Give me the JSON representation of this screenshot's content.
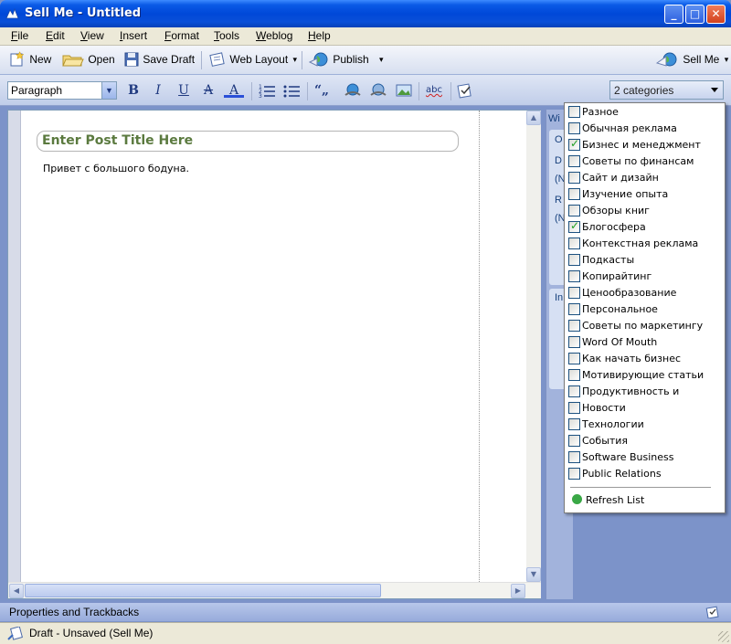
{
  "window": {
    "title": "Sell Me - Untitled",
    "buttons": {
      "minimize": "_",
      "maximize": "□",
      "close": "✕"
    }
  },
  "menu": [
    "File",
    "Edit",
    "View",
    "Insert",
    "Format",
    "Tools",
    "Weblog",
    "Help"
  ],
  "toolbar": {
    "new_label": "New",
    "open_label": "Open",
    "save_draft_label": "Save Draft",
    "web_layout_label": "Web Layout",
    "publish_label": "Publish",
    "blog_label": "Sell Me",
    "dropdown_glyph": "▾"
  },
  "format_toolbar": {
    "paragraph_style": "Paragraph",
    "bold": "B",
    "italic": "I",
    "underline": "U",
    "strikethrough": "A",
    "font_color": "A",
    "quote": "“„",
    "spell": "abc"
  },
  "categories": {
    "selected_summary": "2 categories",
    "items": [
      {
        "label": "Разное",
        "checked": false
      },
      {
        "label": "Обычная реклама",
        "checked": false
      },
      {
        "label": "Бизнес и менеджмент",
        "checked": true
      },
      {
        "label": "Советы по финансам",
        "checked": false
      },
      {
        "label": "Сайт и дизайн",
        "checked": false
      },
      {
        "label": "Изучение опыта",
        "checked": false
      },
      {
        "label": "Обзоры книг",
        "checked": false
      },
      {
        "label": "Блогосфера",
        "checked": true
      },
      {
        "label": "Контекстная реклама",
        "checked": false
      },
      {
        "label": "Подкасты",
        "checked": false
      },
      {
        "label": "Копирайтинг",
        "checked": false
      },
      {
        "label": "Ценообразование",
        "checked": false
      },
      {
        "label": "Персональное",
        "checked": false
      },
      {
        "label": "Советы по маркетингу",
        "checked": false
      },
      {
        "label": "Word Of Mouth",
        "checked": false
      },
      {
        "label": "Как начать бизнес",
        "checked": false
      },
      {
        "label": "Мотивирующие статьи",
        "checked": false
      },
      {
        "label": "Продуктивность и",
        "checked": false
      },
      {
        "label": "Новости",
        "checked": false
      },
      {
        "label": "Технологии",
        "checked": false
      },
      {
        "label": "События",
        "checked": false
      },
      {
        "label": "Software Business",
        "checked": false
      },
      {
        "label": "Public Relations",
        "checked": false
      }
    ],
    "refresh_label": "Refresh List"
  },
  "editor": {
    "title_placeholder": "Enter Post Title Here",
    "body_text": "Привет с большого бодуна."
  },
  "sidebar": {
    "tabs": [
      "Wi",
      "O",
      "D",
      "(N",
      "R",
      "(N",
      "In"
    ]
  },
  "bottom": {
    "properties_label": "Properties and Trackbacks",
    "status_text": "Draft - Unsaved (Sell Me)"
  },
  "colors": {
    "titlebar": "#0048d8",
    "title_text": "#5b7a3f",
    "checkmark": "#21a121"
  }
}
